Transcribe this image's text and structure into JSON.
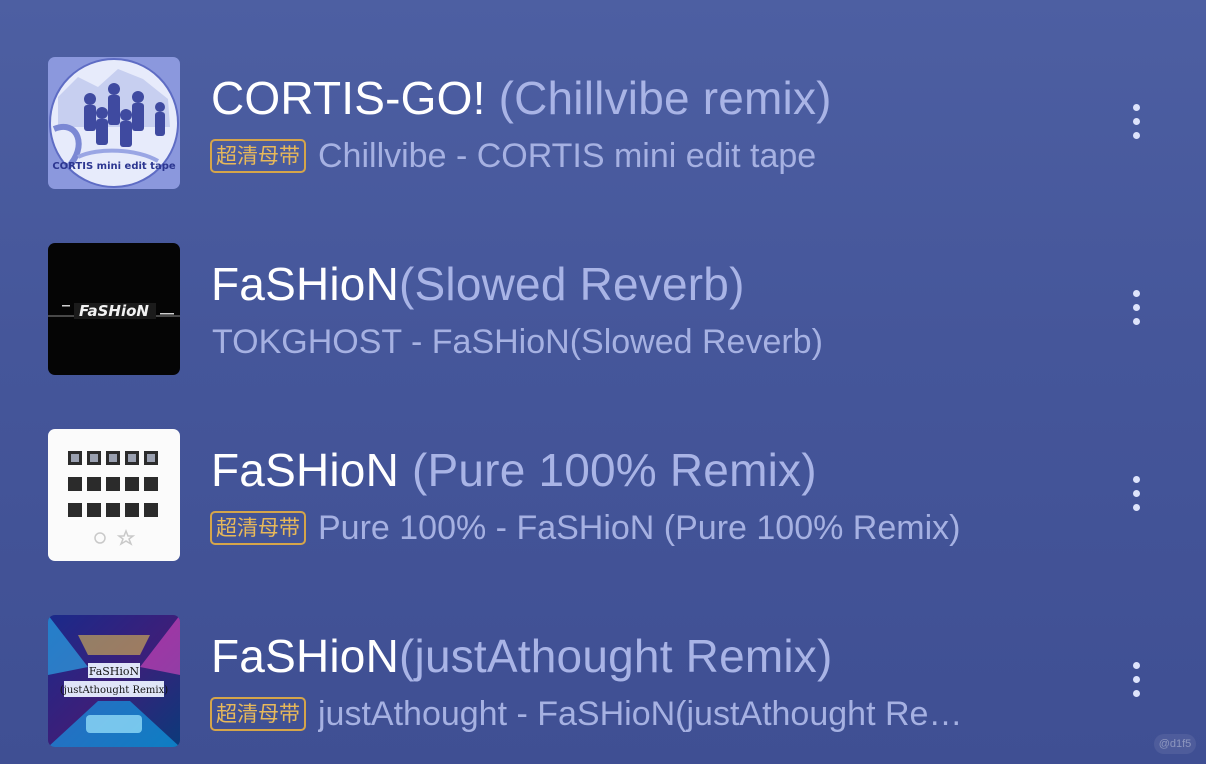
{
  "songs": [
    {
      "title_main": "CORTIS-GO!",
      "title_sub": " (Chillvibe remix)",
      "badge": "超清母带",
      "subtitle": "Chillvibe - CORTIS mini edit tape",
      "cover_text": "CORTIS mini edit tape"
    },
    {
      "title_main": "FaSHioN",
      "title_sub": "(Slowed Reverb)",
      "subtitle": "TOKGHOST - FaSHioN(Slowed Reverb)",
      "cover_text": "FaSHioN"
    },
    {
      "title_main": "FaSHioN",
      "title_sub": " (Pure 100% Remix)",
      "badge": "超清母带",
      "subtitle": "Pure 100% - FaSHioN (Pure 100% Remix)"
    },
    {
      "title_main": "FaSHioN",
      "title_sub": "(justAthought Remix)",
      "badge": "超清母带",
      "subtitle": "justAthought - FaSHioN(justAthought Remix)",
      "cover_text_1": "FaSHioN",
      "cover_text_2": "(justAthought Remix)"
    }
  ],
  "watermark": "@d1f5",
  "colors": {
    "background": "#4a5b9f",
    "title": "#ffffff",
    "title_secondary": "#a9b4e6",
    "badge": "#e8b95a",
    "subtitle": "#a6b1e2"
  },
  "icons": {
    "more": "more-vertical-icon"
  }
}
